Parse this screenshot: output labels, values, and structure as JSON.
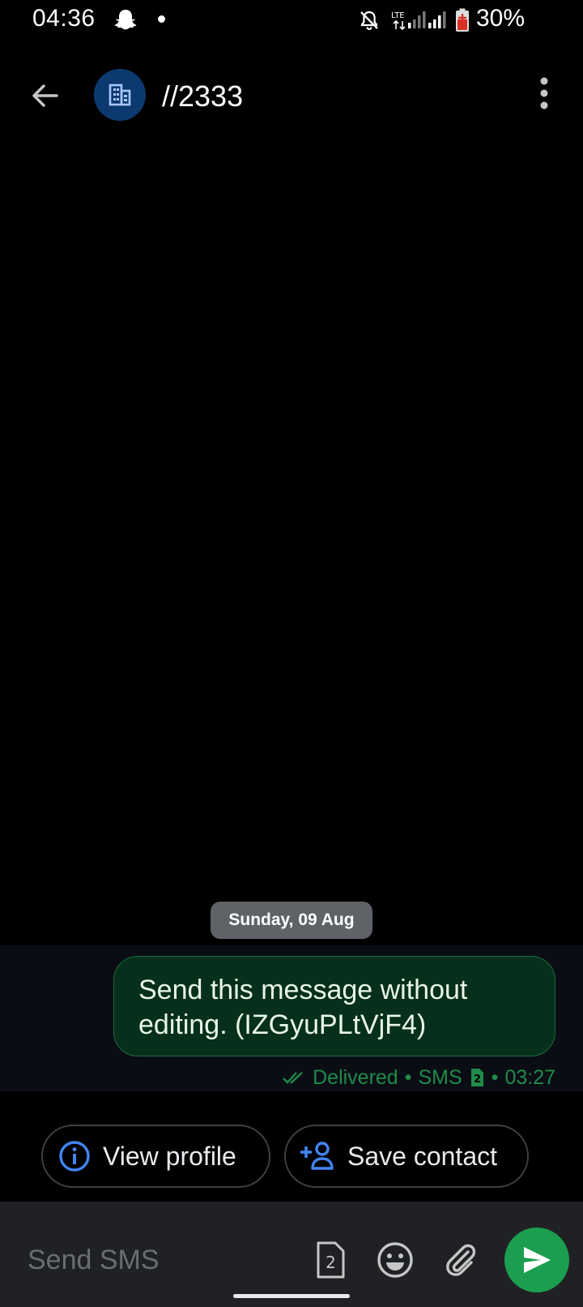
{
  "status_bar": {
    "time": "04:36",
    "battery_percent": "30%",
    "network_label": "LTE"
  },
  "header": {
    "title": "//2333",
    "back_label": "Back",
    "more_label": "More options"
  },
  "conversation": {
    "date_label": "Sunday, 09 Aug",
    "messages": [
      {
        "text": "Send this message without editing. (IZGyuPLtVjF4)",
        "status": "Delivered",
        "channel": "SMS",
        "sim": "2",
        "time": "03:27",
        "separator": "•"
      }
    ]
  },
  "actions": {
    "view_profile": "View profile",
    "save_contact": "Save contact"
  },
  "compose": {
    "placeholder": "Send SMS",
    "value": "",
    "sim_number": "2"
  },
  "colors": {
    "accent_green": "#1b9e50",
    "bubble_fill": "#06301b",
    "chip_icon_blue": "#4285f4",
    "avatar_bg": "#0c3a70"
  },
  "icons": {
    "back": "arrow-back-icon",
    "avatar": "business-building-icon",
    "more": "more-vert-icon",
    "view_profile": "info-icon",
    "save_contact": "person-add-icon",
    "sim": "sim-card-icon",
    "emoji": "emoji-icon",
    "attach": "attach-icon",
    "send": "send-icon"
  }
}
